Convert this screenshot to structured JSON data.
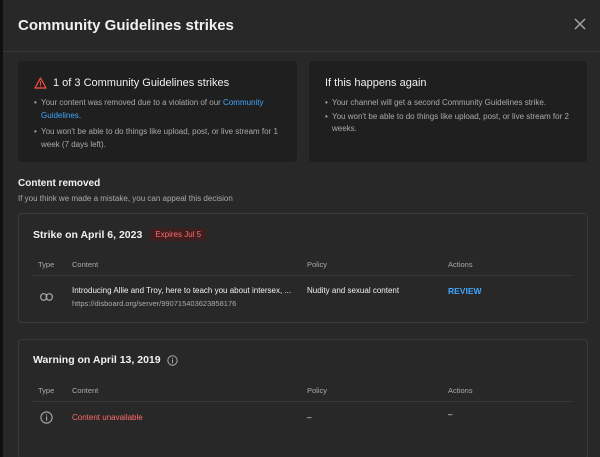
{
  "dialog": {
    "title": "Community Guidelines strikes"
  },
  "strike_card": {
    "heading": "1 of 3 Community Guidelines strikes",
    "bullet1_text": "Your content was removed due to a violation of our ",
    "bullet1_link": "Community Guidelines",
    "bullet1_end": ".",
    "bullet2": "You won't be able to do things like upload, post, or live stream for 1 week (7 days left)."
  },
  "again_card": {
    "heading": "If this happens again",
    "bullet1": "Your channel will get a second Community Guidelines strike.",
    "bullet2": "You won't be able to do things like upload, post, or live stream for 2 weeks."
  },
  "content_removed": {
    "title": "Content removed",
    "subtitle": "If you think we made a mistake, you can appeal this decision"
  },
  "table_headers": {
    "type": "Type",
    "content": "Content",
    "policy": "Policy",
    "actions": "Actions"
  },
  "strike_panel": {
    "title": "Strike on April 6, 2023",
    "badge": "Expires Jul 5",
    "row": {
      "type_icon": "link-icon",
      "content_title": "Introducing Allie and Troy, here to teach you about intersex, ...",
      "content_url": "https://disboard.org/server/990715403623858176",
      "policy": "Nudity and sexual content",
      "action": "REVIEW"
    }
  },
  "warning_panel": {
    "title": "Warning on April 13, 2019",
    "row": {
      "type_icon": "info-icon",
      "content_title": "Content unavailable",
      "policy": "–",
      "action": "–"
    }
  },
  "colors": {
    "accent_link": "#3ea6ff",
    "warning_red": "#ff6b6b"
  }
}
